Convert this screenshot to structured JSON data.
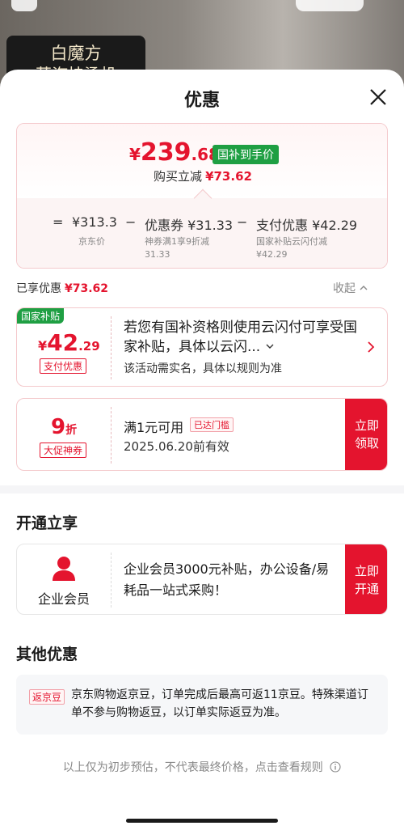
{
  "background": {
    "product_line1": "白魔方",
    "product_line2": "蒸汽挂烫机"
  },
  "sheet": {
    "title": "优惠"
  },
  "price_summary": {
    "currency": "¥",
    "price_int": "239",
    "price_dec": ".68",
    "badge": "国补到手价",
    "reduce_label": "购买立减",
    "reduce_amount": "¥73.62",
    "breakdown": {
      "eq": "=",
      "jd_price": "¥313.3",
      "jd_price_label": "京东价",
      "minus1": "−",
      "coupon": "优惠券 ¥31.33",
      "coupon_sub": "神券满1享9折减",
      "coupon_sub2": "31.33",
      "minus2": "−",
      "payment": "支付优惠 ¥42.29",
      "payment_sub": "国家补贴云闪付减",
      "payment_sub2": "¥42.29"
    }
  },
  "enjoyed": {
    "label": "已享优惠",
    "amount": "¥73.62",
    "collapse": "收起"
  },
  "subsidy": {
    "tag": "国家补贴",
    "currency": "¥",
    "amount_int": "42",
    "amount_dec": ".29",
    "type_label": "支付优惠",
    "text": "若您有国补资格则使用云闪付可享受国家补贴，具体以云闪...",
    "note": "该活动需实名，具体以规则为准"
  },
  "coupon": {
    "discount": "9",
    "unit": "折",
    "type_label": "大促神券",
    "title": "满1元可用",
    "threshold_tag": "已达门槛",
    "expiry": "2025.06.20前有效",
    "claim_line1": "立即",
    "claim_line2": "领取"
  },
  "activate": {
    "title": "开通立享",
    "member_label": "企业会员",
    "text": "企业会员3000元补贴，办公设备/易耗品一站式采购！",
    "btn_line1": "立即",
    "btn_line2": "开通"
  },
  "other": {
    "title": "其他优惠",
    "tag": "返京豆",
    "text": "京东购物返京豆，订单完成后最高可返11京豆。特殊渠道订单不参与购物返豆，以订单实际返豆为准。"
  },
  "footer": {
    "note": "以上仅为初步预估，不代表最终价格，点击查看规则"
  },
  "colors": {
    "accent_red": "#e4142e",
    "subsidy_green": "#1f9f43"
  }
}
